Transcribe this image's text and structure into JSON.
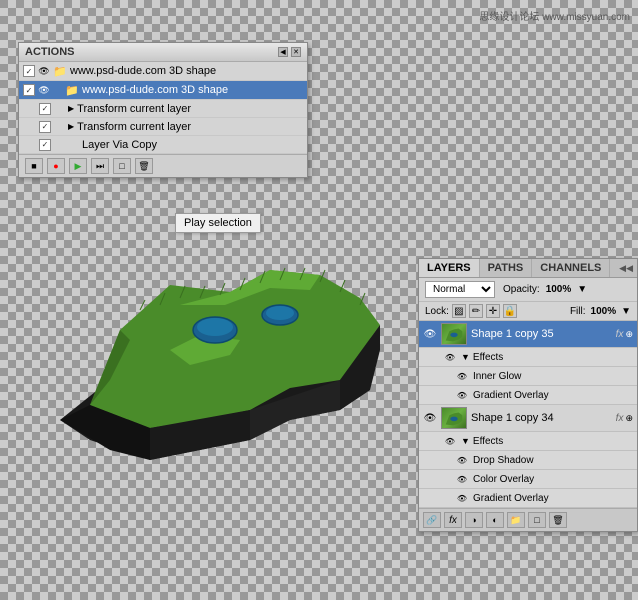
{
  "watermark": {
    "text": "思缘设计论坛 www.missyuan.com"
  },
  "actions_panel": {
    "title": "ACTIONS",
    "rows": [
      {
        "id": "row1",
        "checked": true,
        "eye": true,
        "indent": 0,
        "icon": "folder",
        "text": "www.psd-dude.com 3D shape",
        "selected": false
      },
      {
        "id": "row2",
        "checked": true,
        "eye": true,
        "indent": 1,
        "icon": "folder",
        "text": "www.psd-dude.com 3D shape",
        "selected": true
      },
      {
        "id": "row3",
        "checked": true,
        "eye": false,
        "indent": 2,
        "icon": "play",
        "text": "Transform current layer",
        "selected": false
      },
      {
        "id": "row4",
        "checked": true,
        "eye": false,
        "indent": 2,
        "icon": "play",
        "text": "Transform current layer",
        "selected": false
      },
      {
        "id": "row5",
        "checked": true,
        "eye": false,
        "indent": 2,
        "icon": "none",
        "text": "Layer Via Copy",
        "selected": false
      }
    ],
    "toolbar_buttons": [
      "stop",
      "record",
      "play",
      "forward",
      "new",
      "delete"
    ]
  },
  "play_selection_button": {
    "label": "Play selection"
  },
  "layers_panel": {
    "tabs": [
      {
        "id": "layers",
        "label": "LAYERS",
        "active": true
      },
      {
        "id": "paths",
        "label": "PATHS",
        "active": false
      },
      {
        "id": "channels",
        "label": "CHANNELS",
        "active": false
      }
    ],
    "blend_mode": "Normal",
    "opacity_label": "Opacity:",
    "opacity_value": "100%",
    "lock_label": "Lock:",
    "fill_label": "Fill:",
    "fill_value": "100%",
    "layers": [
      {
        "id": "layer1",
        "name": "Shape 1 copy 35",
        "selected": true,
        "visible": true,
        "has_thumb": true,
        "fx": true,
        "effects": [
          {
            "label": "Effects",
            "type": "effects-header"
          },
          {
            "label": "Inner Glow",
            "type": "effect"
          },
          {
            "label": "Gradient Overlay",
            "type": "effect"
          }
        ]
      },
      {
        "id": "layer2",
        "name": "Shape 1 copy 34",
        "selected": false,
        "visible": true,
        "has_thumb": true,
        "fx": true,
        "effects": [
          {
            "label": "Effects",
            "type": "effects-header"
          },
          {
            "label": "Drop Shadow",
            "type": "effect"
          },
          {
            "label": "Color Overlay",
            "type": "effect"
          },
          {
            "label": "Gradient Overlay",
            "type": "effect"
          }
        ]
      }
    ],
    "bottom_buttons": [
      "link",
      "fx",
      "adjustment",
      "folder",
      "new",
      "delete"
    ]
  }
}
